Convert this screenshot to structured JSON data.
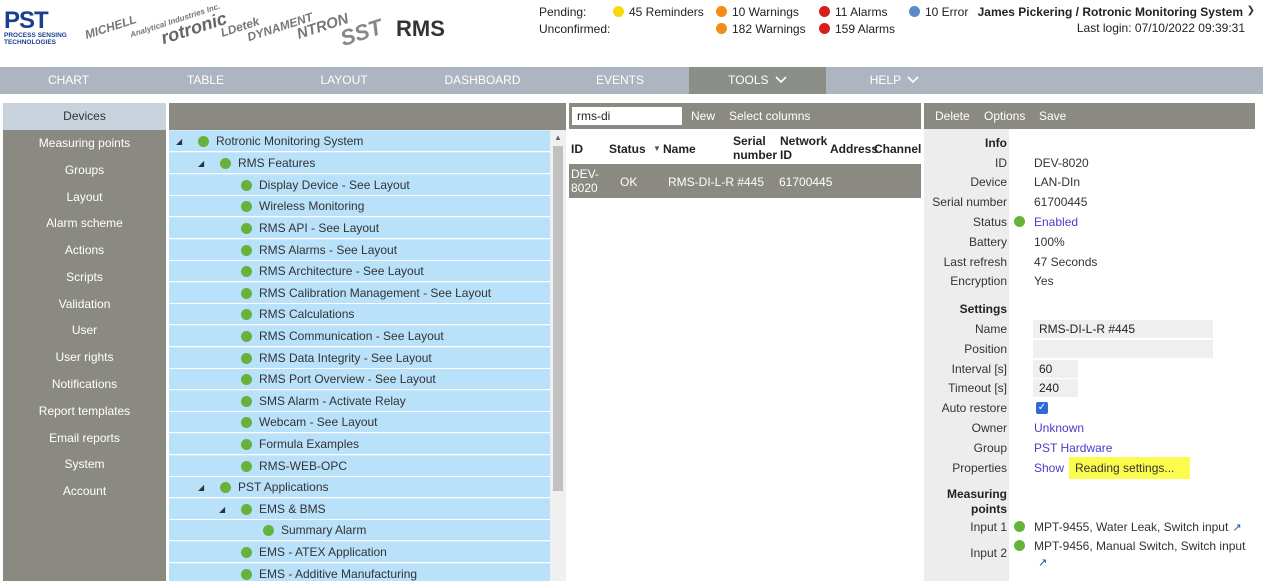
{
  "header": {
    "logo_big": "PST",
    "logo_small_1": "PROCESS SENSING",
    "logo_small_2": "TECHNOLOGIES",
    "brands": [
      "MICHELL",
      "Analytical Industries Inc.",
      "rotronic",
      "LDetek",
      "DYNAMENT",
      "NTRON",
      "SST"
    ],
    "app_title": "RMS",
    "pending_label": "Pending:",
    "unconfirmed_label": "Unconfirmed:",
    "pending": {
      "reminders": "45 Reminders",
      "warnings": "10 Warnings",
      "alarms": "11 Alarms",
      "errors": "10 Error"
    },
    "unconfirmed": {
      "warnings": "182 Warnings",
      "alarms": "159 Alarms"
    },
    "user": "James Pickering / Rotronic Monitoring System",
    "last_login": "Last login: 07/10/2022 09:39:31",
    "colors": {
      "reminder": "#f5d90a",
      "warning": "#f28c16",
      "alarm": "#d62020",
      "error": "#5b8cc8"
    }
  },
  "nav": {
    "items": [
      "CHART",
      "TABLE",
      "LAYOUT",
      "DASHBOARD",
      "EVENTS",
      "TOOLS",
      "HELP"
    ],
    "active": "TOOLS"
  },
  "sidebar": {
    "items": [
      "Devices",
      "Measuring points",
      "Groups",
      "Layout",
      "Alarm scheme",
      "Actions",
      "Scripts",
      "Validation",
      "User",
      "User rights",
      "Notifications",
      "Report templates",
      "Email reports",
      "System",
      "Account"
    ],
    "active": "Devices"
  },
  "tree": {
    "rows": [
      "Rotronic Monitoring System",
      "RMS Features",
      "Display Device - See Layout",
      "Wireless Monitoring",
      "RMS API - See Layout",
      "RMS Alarms - See Layout",
      "RMS Architecture - See Layout",
      "RMS Calibration Management - See Layout",
      "RMS Calculations",
      "RMS Communication - See Layout",
      "RMS Data Integrity - See Layout",
      "RMS Port Overview - See Layout",
      "SMS Alarm - Activate Relay",
      "Webcam - See Layout",
      "Formula Examples",
      "RMS-WEB-OPC",
      "PST Applications",
      "EMS & BMS",
      "Summary Alarm",
      "EMS - ATEX Application",
      "EMS - Additive Manufacturing"
    ]
  },
  "list": {
    "search_value": "rms-di",
    "new_label": "New",
    "select_columns_label": "Select columns",
    "columns": {
      "id": "ID",
      "status": "Status",
      "name": "Name",
      "serial_1": "Serial",
      "serial_2": "number",
      "network_1": "Network",
      "network_2": "ID",
      "address": "Address",
      "channel": "Channel"
    },
    "row": {
      "id_1": "DEV-",
      "id_2": "8020",
      "status": "OK",
      "name": "RMS-DI-L-R #445",
      "serial": "61700445"
    }
  },
  "detail": {
    "toolbar": {
      "delete": "Delete",
      "options": "Options",
      "save": "Save"
    },
    "info_title": "Info",
    "labels": {
      "id": "ID",
      "device": "Device",
      "serial": "Serial number",
      "status": "Status",
      "battery": "Battery",
      "last_refresh": "Last refresh",
      "encryption": "Encryption",
      "name": "Name",
      "position": "Position",
      "interval": "Interval [s]",
      "timeout": "Timeout [s]",
      "auto_restore": "Auto restore",
      "owner": "Owner",
      "group": "Group",
      "properties": "Properties",
      "input1": "Input 1",
      "input2": "Input 2"
    },
    "values": {
      "id": "DEV-8020",
      "device": "LAN-DIn",
      "serial": "61700445",
      "status": "Enabled",
      "battery": "100%",
      "last_refresh": "47 Seconds",
      "encryption": "Yes",
      "name": "RMS-DI-L-R #445",
      "position": "",
      "interval": "60",
      "timeout": "240",
      "owner": "Unknown",
      "group": "PST Hardware",
      "properties_show": "Show",
      "properties_reading": "Reading settings...",
      "input1": "MPT-9455, Water Leak, Switch input",
      "input2": "MPT-9456, Manual Switch, Switch input"
    },
    "settings_title": "Settings",
    "measuring_title_1": "Measuring",
    "measuring_title_2": "points"
  }
}
